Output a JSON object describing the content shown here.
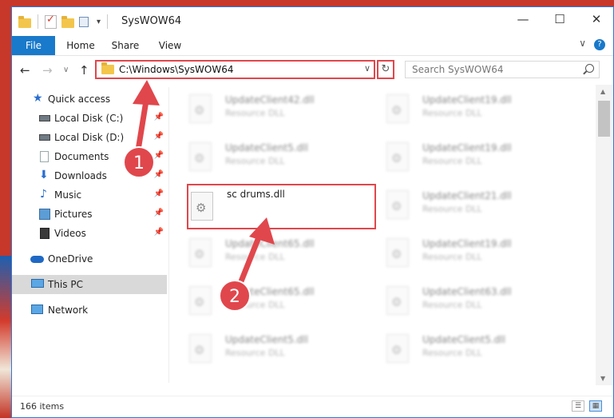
{
  "window": {
    "title": "SysWOW64",
    "buttons": {
      "minimize": "—",
      "maximize": "☐",
      "close": "✕"
    }
  },
  "ribbon": {
    "tabs": [
      "File",
      "Home",
      "Share",
      "View"
    ],
    "help": "?",
    "collapse": "∨"
  },
  "nav": {
    "back": "←",
    "forward": "→",
    "recent": "∨",
    "up": "↑",
    "address": "C:\\Windows\\SysWOW64",
    "address_dropdown": "∨",
    "refresh": "↻",
    "search_placeholder": "Search SysWOW64"
  },
  "sidebar": {
    "items": [
      {
        "label": "Quick access",
        "icon": "star-icon"
      },
      {
        "label": "Local Disk (C:)",
        "icon": "drive-icon",
        "pinned": true
      },
      {
        "label": "Local Disk (D:)",
        "icon": "drive-icon",
        "pinned": true
      },
      {
        "label": "Documents",
        "icon": "documents-icon",
        "pinned": true
      },
      {
        "label": "Downloads",
        "icon": "downloads-icon",
        "pinned": true
      },
      {
        "label": "Music",
        "icon": "music-icon",
        "pinned": true
      },
      {
        "label": "Pictures",
        "icon": "pictures-icon",
        "pinned": true
      },
      {
        "label": "Videos",
        "icon": "videos-icon",
        "pinned": true
      },
      {
        "label": "OneDrive",
        "icon": "onedrive-icon"
      },
      {
        "label": "This PC",
        "icon": "pc-icon",
        "selected": true
      },
      {
        "label": "Network",
        "icon": "network-icon"
      }
    ],
    "pin_glyph": "📌"
  },
  "files": [
    {
      "name": "UpdateClient42.dll",
      "type": "Resource DLL"
    },
    {
      "name": "UpdateClient19.dll",
      "type": "Resource DLL"
    },
    {
      "name": "UpdateClient5.dll",
      "type": "Resource DLL"
    },
    {
      "name": "UpdateClient19.dll",
      "type": "Resource DLL"
    },
    {
      "name": "sc drums.dll",
      "type": ""
    },
    {
      "name": "UpdateClient21.dll",
      "type": "Resource DLL"
    },
    {
      "name": "UpdateClient65.dll",
      "type": "Resource DLL"
    },
    {
      "name": "UpdateClient19.dll",
      "type": "Resource DLL"
    },
    {
      "name": "UpdateClient65.dll",
      "type": "Resource DLL"
    },
    {
      "name": "UpdateClient63.dll",
      "type": "Resource DLL"
    },
    {
      "name": "UpdateClient5.dll",
      "type": "Resource DLL"
    },
    {
      "name": "UpdateClient5.dll",
      "type": "Resource DLL"
    }
  ],
  "status": {
    "item_count": "166 items"
  },
  "annotations": {
    "step1": "1",
    "step2": "2",
    "accent_color": "#e0474c"
  }
}
